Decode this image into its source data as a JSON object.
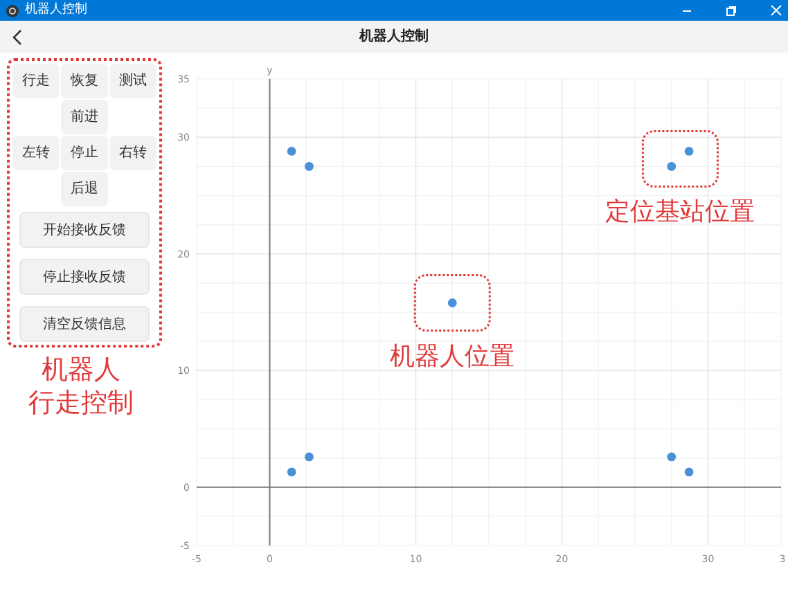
{
  "window": {
    "title": "机器人控制"
  },
  "header": {
    "title": "机器人控制"
  },
  "control_panel": {
    "buttons": [
      {
        "label": "行走"
      },
      {
        "label": "恢复"
      },
      {
        "label": "测试"
      },
      {
        "label": "前进"
      },
      {
        "label": "左转"
      },
      {
        "label": "停止"
      },
      {
        "label": "右转"
      },
      {
        "label": "后退"
      }
    ],
    "wide_buttons": [
      {
        "label": "开始接收反馈"
      },
      {
        "label": "停止接收反馈"
      },
      {
        "label": "清空反馈信息"
      }
    ],
    "annotation": [
      "机器人",
      "行走控制"
    ]
  },
  "chart_data": {
    "type": "scatter",
    "ylabel": "y",
    "xlim": [
      -5,
      35
    ],
    "ylim": [
      -5,
      35
    ],
    "xticks": [
      -5,
      0,
      10,
      20,
      30
    ],
    "yticks": [
      -5,
      0,
      10,
      20,
      30,
      35
    ],
    "grid": true,
    "series": [
      {
        "color": "#4a90d9",
        "x": [
          1.5,
          2.7,
          12.5,
          27.5,
          28.7,
          2.7,
          1.5,
          27.5,
          28.7
        ],
        "values": [
          28.8,
          27.5,
          15.8,
          27.5,
          28.8,
          2.6,
          1.3,
          2.6,
          1.3
        ]
      }
    ],
    "annotations": [
      "机器人位置",
      "定位基站位置"
    ]
  },
  "chart_cut_tick_label": "3"
}
